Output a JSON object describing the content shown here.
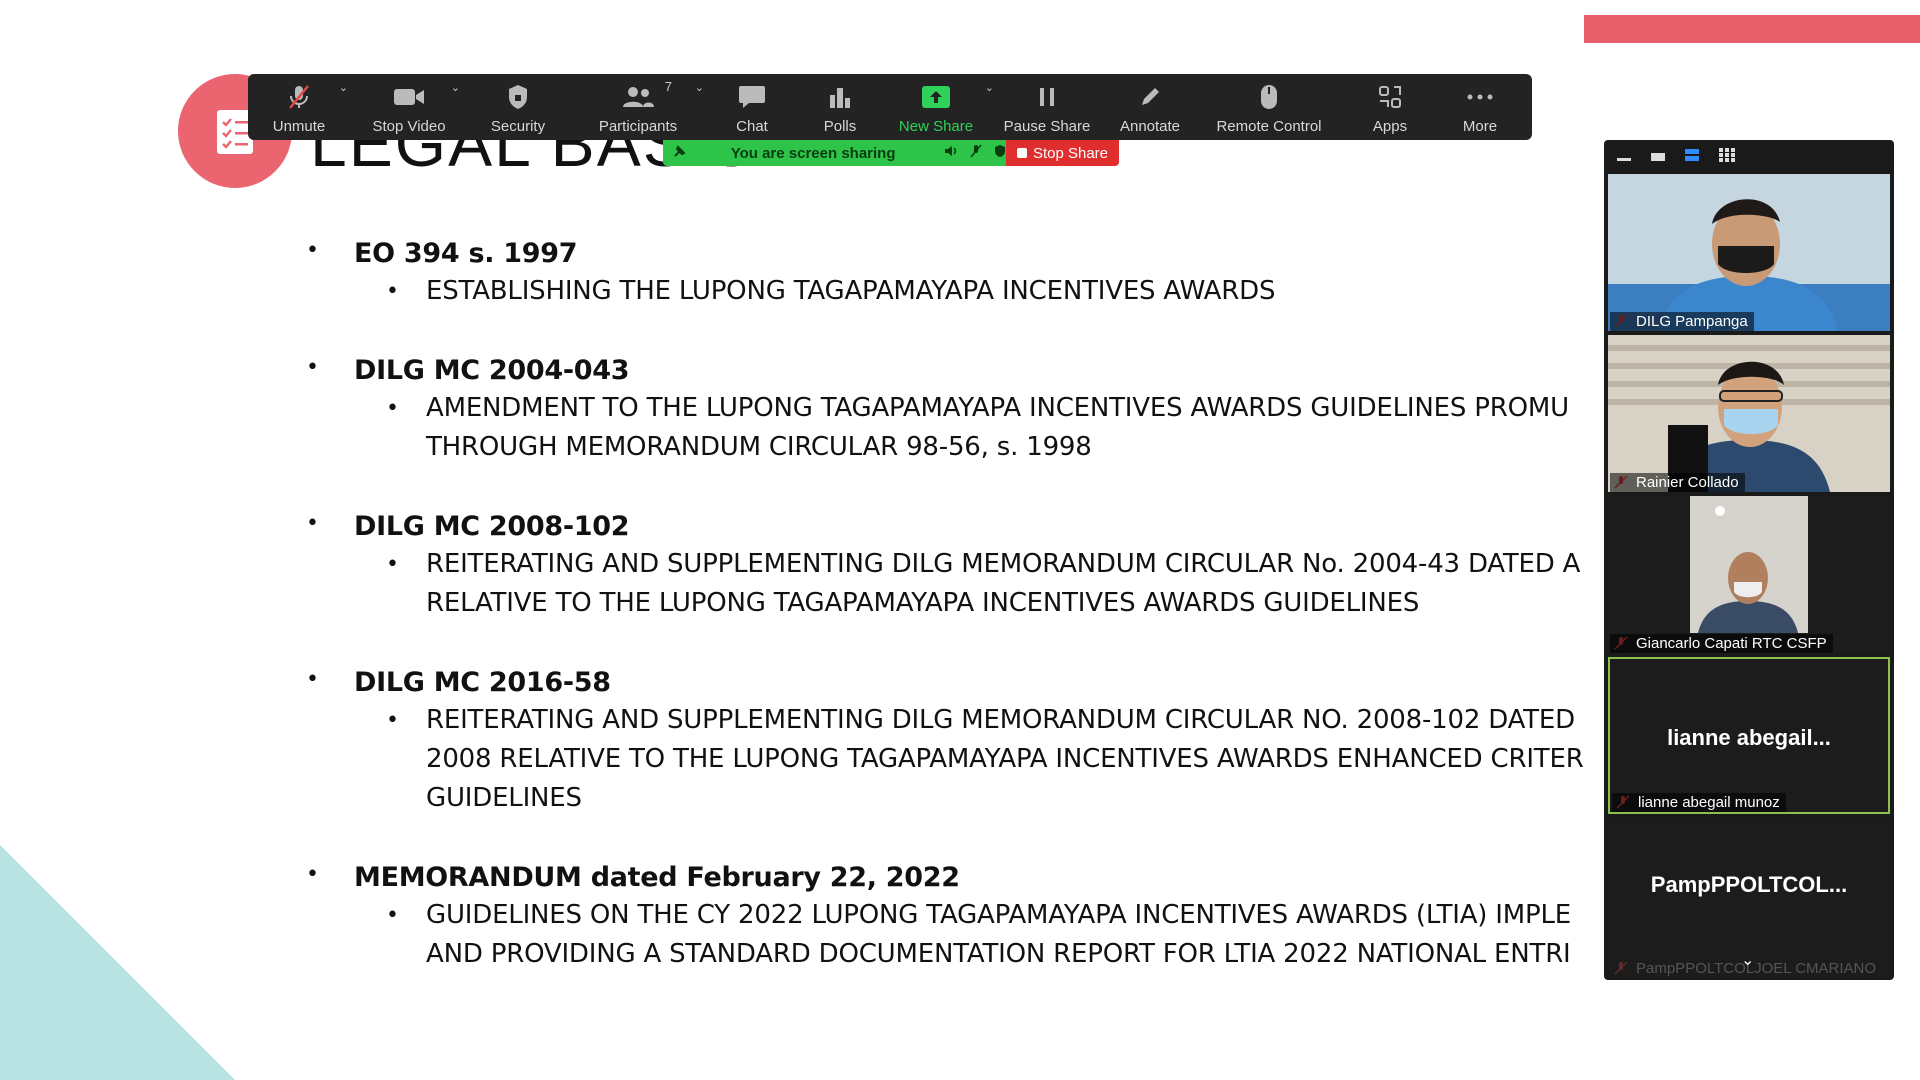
{
  "slide": {
    "title": "LEGAL BASIS",
    "items": [
      {
        "head": "EO 394 s. 1997",
        "sub": "ESTABLISHING THE LUPONG TAGAPAMAYAPA INCENTIVES AWARDS"
      },
      {
        "head": "DILG MC 2004-043",
        "sub": "AMENDMENT TO THE LUPONG TAGAPAMAYAPA INCENTIVES AWARDS GUIDELINES PROMU\nTHROUGH MEMORANDUM CIRCULAR 98-56, s. 1998"
      },
      {
        "head": "DILG MC 2008-102",
        "sub": "REITERATING AND SUPPLEMENTING DILG MEMORANDUM CIRCULAR No. 2004-43 DATED A\nRELATIVE TO THE LUPONG TAGAPAMAYAPA INCENTIVES AWARDS GUIDELINES"
      },
      {
        "head": "DILG MC 2016-58",
        "sub": "REITERATING AND SUPPLEMENTING DILG MEMORANDUM CIRCULAR NO. 2008-102 DATED\n2008 RELATIVE TO THE LUPONG TAGAPAMAYAPA INCENTIVES AWARDS ENHANCED CRITER\nGUIDELINES"
      },
      {
        "head": "MEMORANDUM dated February 22, 2022",
        "sub": "GUIDELINES ON THE CY 2022 LUPONG TAGAPAMAYAPA INCENTIVES AWARDS (LTIA) IMPLE\nAND PROVIDING A STANDARD DOCUMENTATION REPORT FOR LTIA 2022 NATIONAL ENTRI"
      }
    ]
  },
  "toolbar": {
    "unmute": "Unmute",
    "stop_video": "Stop Video",
    "security": "Security",
    "participants": "Participants",
    "participants_count": "7",
    "chat": "Chat",
    "polls": "Polls",
    "new_share": "New Share",
    "pause_share": "Pause Share",
    "annotate": "Annotate",
    "remote_control": "Remote Control",
    "apps": "Apps",
    "more": "More"
  },
  "share_bar": {
    "status": "You are screen sharing",
    "stop_label": "Stop Share"
  },
  "gallery": {
    "participants": [
      {
        "name": "DILG Pampanga"
      },
      {
        "name": "Rainier Collado"
      },
      {
        "name": "Giancarlo Capati RTC CSFP"
      },
      {
        "name": "lianne abegail munoz",
        "display": "lianne  abegail..."
      },
      {
        "name": "PampPPOLTCOLJOEL CMARIANO",
        "display": "PampPPOLTCOL..."
      }
    ]
  },
  "colors": {
    "accent_pink": "#e9606c",
    "teal": "#b9e2e2",
    "share_green": "#2ec44a",
    "stop_red": "#e02e2e"
  }
}
